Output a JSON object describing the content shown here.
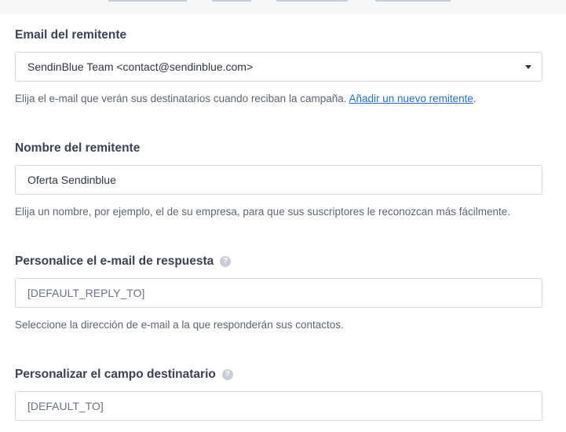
{
  "sections": {
    "sender_email": {
      "label": "Email del remitente",
      "value": "SendinBlue Team <contact@sendinblue.com>",
      "hint": "Elija el e-mail que verán sus destinatarios cuando reciban la campaña. ",
      "hint_link": "Añadir un nuevo remitente",
      "hint_suffix": "."
    },
    "sender_name": {
      "label": "Nombre del remitente",
      "value": "Oferta Sendinblue",
      "hint": "Elija un nombre, por ejemplo, el de su empresa, para que sus suscriptores le reconozcan más fácilmente."
    },
    "reply_to": {
      "label": "Personalice el e-mail de respuesta",
      "value": "[DEFAULT_REPLY_TO]",
      "hint": "Seleccione la dirección de e-mail a la que responderán sus contactos."
    },
    "to_field": {
      "label": "Personalizar el campo destinatario",
      "value": "[DEFAULT_TO]"
    }
  },
  "icons": {
    "help": "question-mark",
    "dropdown": "caret-down"
  },
  "colors": {
    "link": "#1f6fd1",
    "border": "#d3d7de",
    "label": "#3b4252",
    "hint": "#5b6472"
  }
}
